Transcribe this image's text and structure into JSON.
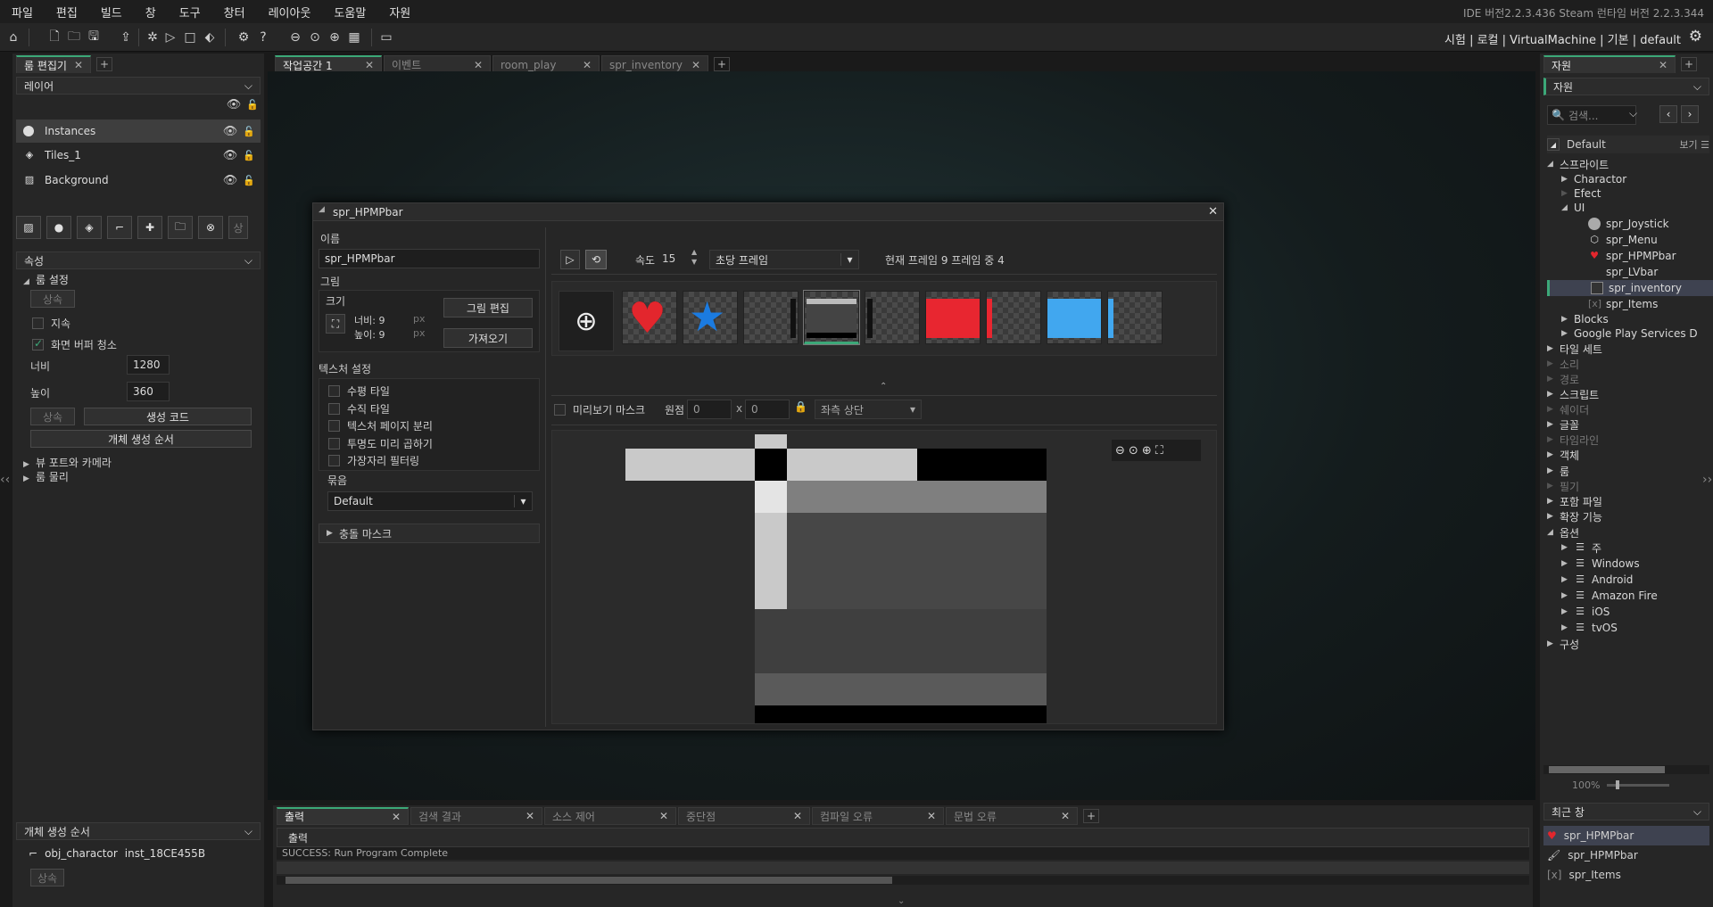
{
  "menu": [
    "파일",
    "편집",
    "빌드",
    "창",
    "도구",
    "창터",
    "레이아웃",
    "도움말",
    "자원"
  ],
  "version_text": "IDE 버전2.2.3.436 Steam 런타임 버전 2.2.3.344",
  "target_text": "시험 | 로컬 | VirtualMachine | 기본 | default",
  "left_panel": {
    "tab": "룸 편집기",
    "layers_header": "레이어",
    "layers": [
      "Instances",
      "Tiles_1",
      "Background"
    ],
    "properties_header": "속성",
    "room_settings": "룸 설정",
    "inherit": "상속",
    "persistent": "지속",
    "clear_display": "화면 버퍼 청소",
    "width_label": "너비",
    "width_value": "1280",
    "height_label": "높이",
    "height_value": "360",
    "inherit2": "상속",
    "creation_code": "생성 코드",
    "instance_order": "개체 생성 순서",
    "viewports": "뷰 포트와 카메라",
    "physics": "룸 물리",
    "creation_order_header": "개체 생성 순서",
    "order_object": "obj_charactor",
    "order_instance": "inst_18CE455B",
    "inherit3": "상속"
  },
  "tabs": [
    {
      "label": "작업공간 1",
      "active": true
    },
    {
      "label": "이벤트",
      "active": false
    },
    {
      "label": "room_play",
      "active": false
    },
    {
      "label": "spr_inventory",
      "active": false
    }
  ],
  "sprite_editor": {
    "title": "spr_HPMPbar",
    "name_label": "이름",
    "name_value": "spr_HPMPbar",
    "image_label": "그림",
    "size_label": "크기",
    "width_text": "너비: 9",
    "height_text": "높이: 9",
    "px": "px",
    "edit_image": "그림 편집",
    "import": "가져오기",
    "texture_settings": "텍스처 설정",
    "tex_options": [
      "수평 타일",
      "수직 타일",
      "텍스처 페이지 분리",
      "투명도 미리 곱하기",
      "가장자리 필터링"
    ],
    "group_label": "묶음",
    "group_value": "Default",
    "collision_mask": "충돌 마스크",
    "speed_label": "속도",
    "speed_value": "15",
    "speed_unit": "초당 프레임",
    "frame_info": "현재 프레임 9 프레임 중 4",
    "preview_mask": "미리보기 마스크",
    "origin_label": "원점",
    "origin_x": "0",
    "origin_y": "0",
    "x_sep": "x",
    "origin_mode": "좌측 상단"
  },
  "bottom": {
    "tabs": [
      "출력",
      "검색 결과",
      "소스 제어",
      "중단점",
      "컴파일 오류",
      "문법 오류"
    ],
    "output_header": "출력",
    "output_line": "SUCCESS: Run Program Complete"
  },
  "right_panel": {
    "tab": "자원",
    "header": "자원",
    "search_placeholder": "검색...",
    "default_label": "Default",
    "view_label": "보기",
    "tree": [
      {
        "label": "스프라이트",
        "level": 0,
        "open": true
      },
      {
        "label": "Charactor",
        "level": 1
      },
      {
        "label": "Efect",
        "level": 1
      },
      {
        "label": "UI",
        "level": 1,
        "open": true
      },
      {
        "label": "spr_Joystick",
        "level": 2
      },
      {
        "label": "spr_Menu",
        "level": 2
      },
      {
        "label": "spr_HPMPbar",
        "level": 2
      },
      {
        "label": "spr_LVbar",
        "level": 2
      },
      {
        "label": "spr_inventory",
        "level": 2,
        "selected": true
      },
      {
        "label": "spr_Items",
        "level": 2
      },
      {
        "label": "Blocks",
        "level": 1
      },
      {
        "label": "Google Play Services D",
        "level": 1
      },
      {
        "label": "타일 세트",
        "level": 0
      },
      {
        "label": "소리",
        "level": 0,
        "dim": true
      },
      {
        "label": "경로",
        "level": 0,
        "dim": true
      },
      {
        "label": "스크립트",
        "level": 0
      },
      {
        "label": "쉐이더",
        "level": 0,
        "dim": true
      },
      {
        "label": "글꼴",
        "level": 0
      },
      {
        "label": "타임라인",
        "level": 0,
        "dim": true
      },
      {
        "label": "객체",
        "level": 0
      },
      {
        "label": "룸",
        "level": 0
      },
      {
        "label": "필기",
        "level": 0,
        "dim": true
      },
      {
        "label": "포함 파일",
        "level": 0
      },
      {
        "label": "확장 기능",
        "level": 0
      },
      {
        "label": "옵션",
        "level": 0,
        "open": true
      },
      {
        "label": "주",
        "level": 1
      },
      {
        "label": "Windows",
        "level": 1
      },
      {
        "label": "Android",
        "level": 1
      },
      {
        "label": "Amazon Fire",
        "level": 1
      },
      {
        "label": "iOS",
        "level": 1
      },
      {
        "label": "tvOS",
        "level": 1
      },
      {
        "label": "구성",
        "level": 0
      }
    ],
    "zoom": "100%",
    "recent_header": "최근 창",
    "recent": [
      "spr_HPMPbar",
      "spr_HPMPbar",
      "spr_Items"
    ]
  },
  "colors": {
    "accent": "#3ca878",
    "heart": "#e3262d",
    "star": "#1b7be0",
    "red_bar": "#e82630",
    "blue_bar": "#41a7ef"
  }
}
